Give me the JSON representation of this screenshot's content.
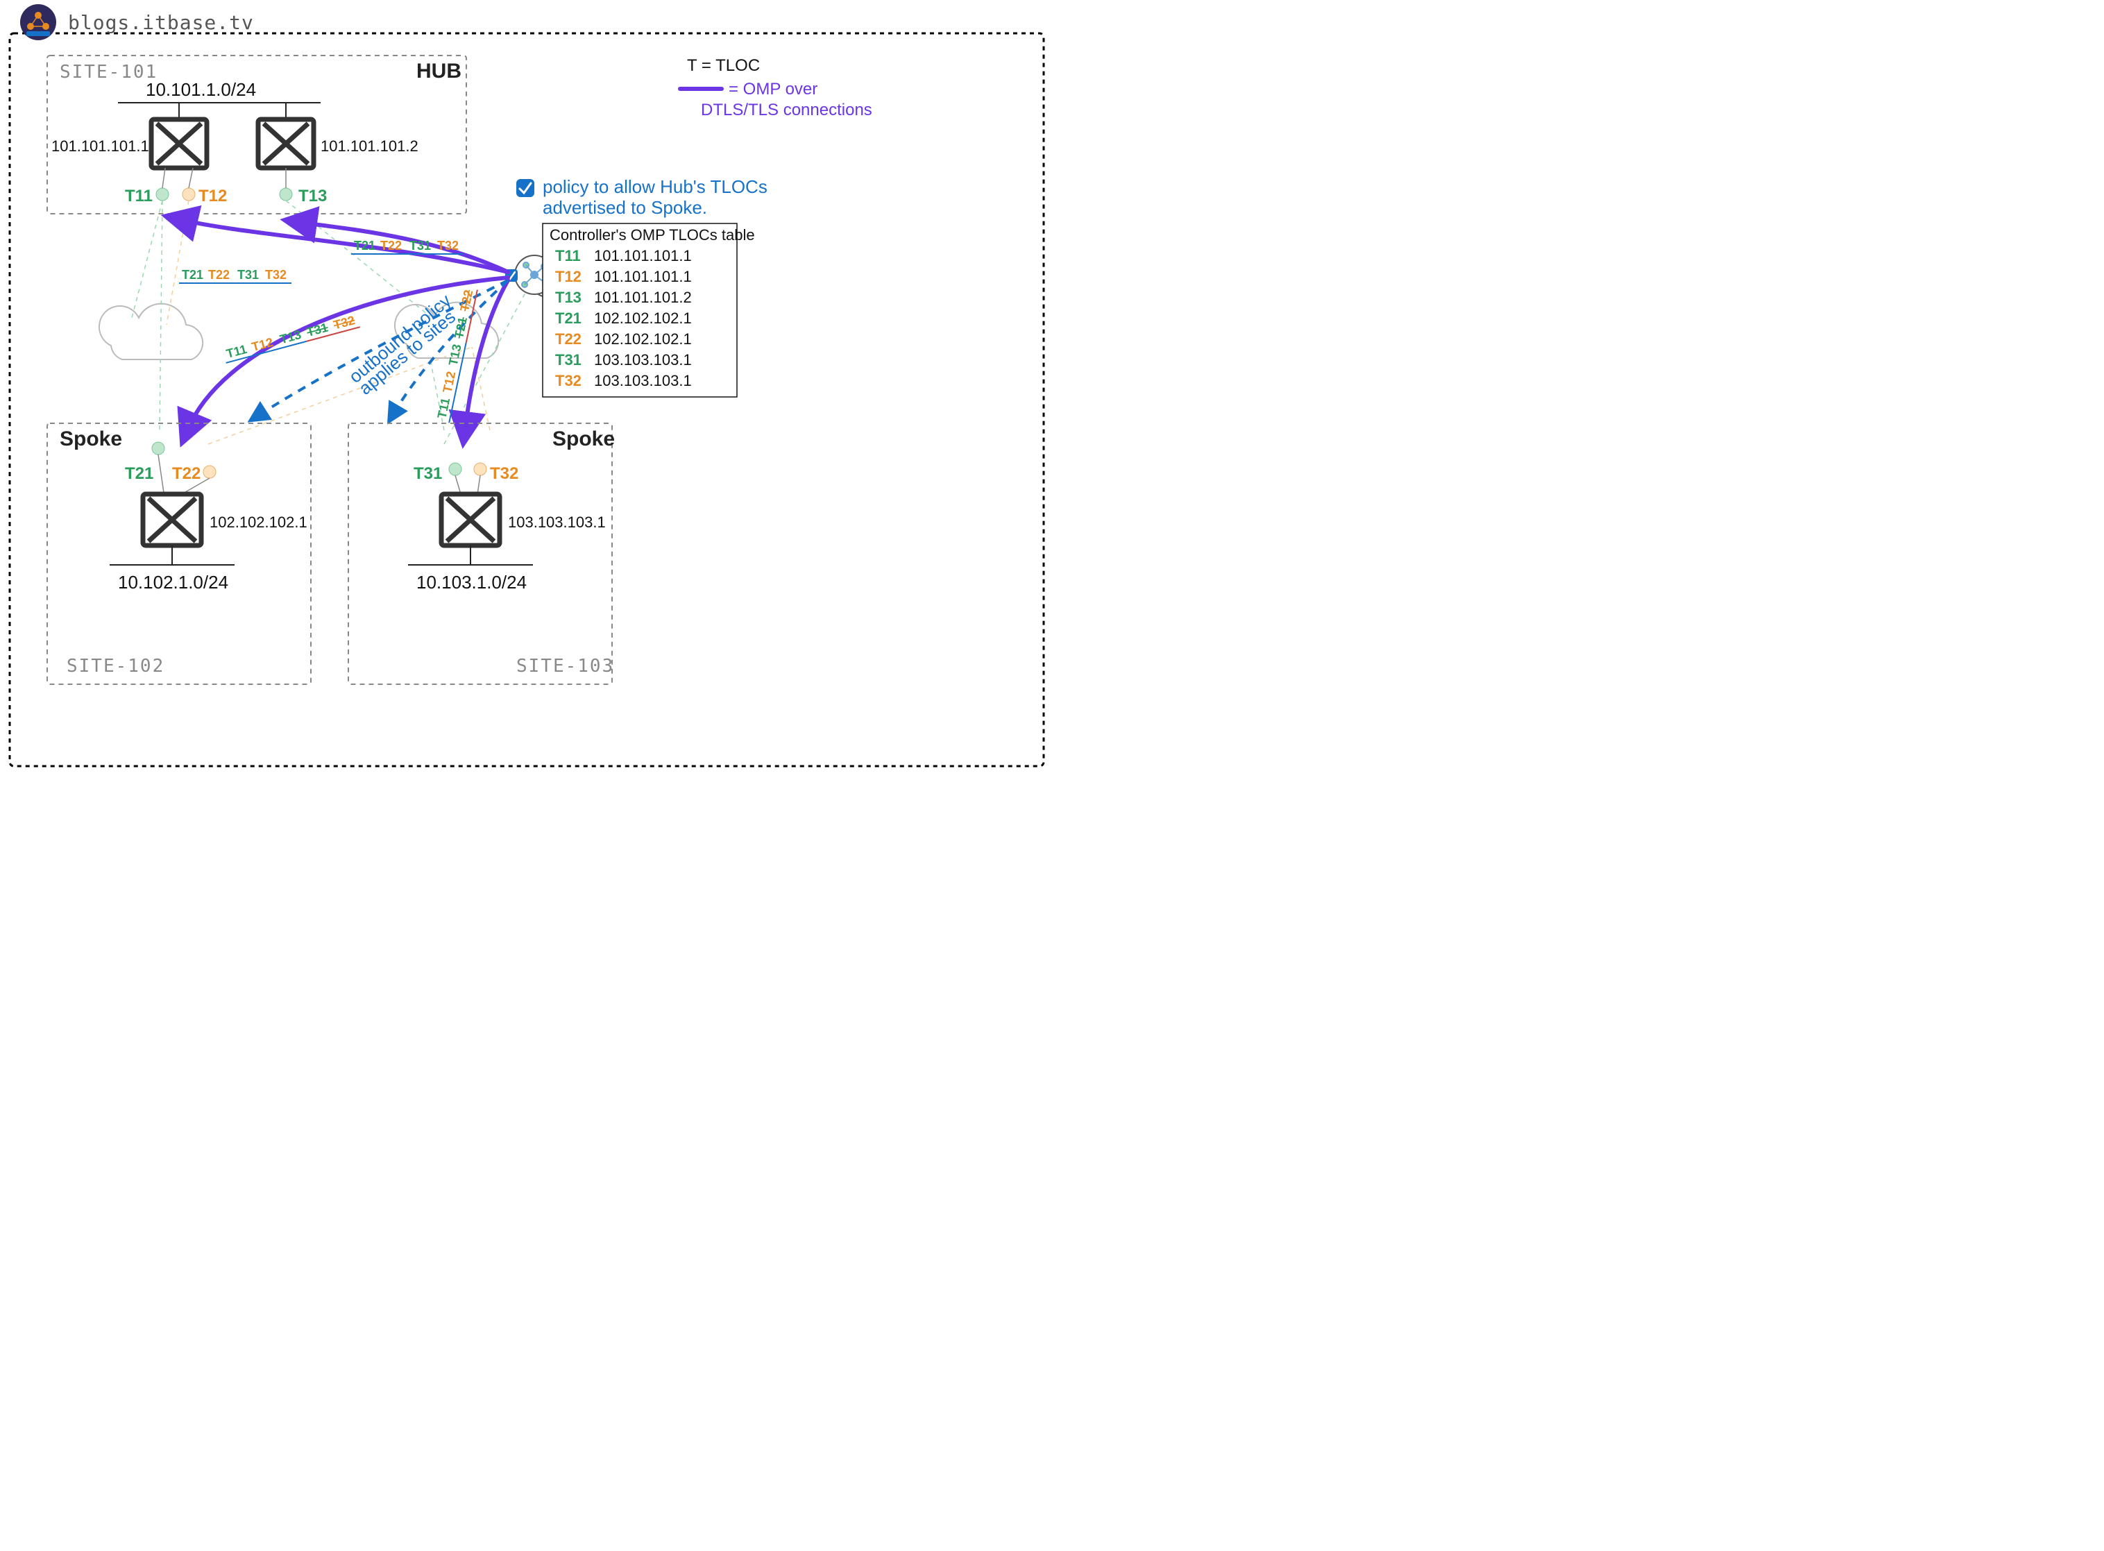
{
  "header": {
    "blog": "blogs.itbase.tv"
  },
  "legend": {
    "line1": "T = TLOC",
    "line2a": "= OMP over",
    "line2b": "DTLS/TLS connections"
  },
  "policy": {
    "line1": "policy to allow Hub's TLOCs",
    "line2": "advertised to Spoke.",
    "flowA": "outbound policy",
    "flowB": "applies to sites"
  },
  "controllerTable": {
    "title": "Controller's OMP TLOCs table",
    "rows": [
      {
        "t": "T11",
        "c": "g",
        "ip": "101.101.101.1"
      },
      {
        "t": "T12",
        "c": "o",
        "ip": "101.101.101.1"
      },
      {
        "t": "T13",
        "c": "g",
        "ip": "101.101.101.2"
      },
      {
        "t": "T21",
        "c": "g",
        "ip": "102.102.102.1"
      },
      {
        "t": "T22",
        "c": "o",
        "ip": "102.102.102.1"
      },
      {
        "t": "T31",
        "c": "g",
        "ip": "103.103.103.1"
      },
      {
        "t": "T32",
        "c": "o",
        "ip": "103.103.103.1"
      }
    ]
  },
  "site101": {
    "id": "SITE-101",
    "role": "HUB",
    "net": "10.101.1.0/24",
    "r1ip": "101.101.101.1",
    "r2ip": "101.101.101.2",
    "t11": "T11",
    "t12": "T12",
    "t13": "T13"
  },
  "site102": {
    "id": "SITE-102",
    "role": "Spoke",
    "net": "10.102.1.0/24",
    "ip": "102.102.102.1",
    "t21": "T21",
    "t22": "T22"
  },
  "site103": {
    "id": "SITE-103",
    "role": "Spoke",
    "net": "10.103.1.0/24",
    "ip": "103.103.103.1",
    "t31": "T31",
    "t32": "T32"
  },
  "edgeToHub1": {
    "a": "T21",
    "b": "T22",
    "c": "T31",
    "d": "T32"
  },
  "edgeToHub2": {
    "a": "T21",
    "b": "T22",
    "c": "T31",
    "d": "T32"
  },
  "edgeToSpoke102": {
    "a": "T11",
    "b": "T12",
    "c": "T13",
    "d": "T31",
    "e": "T32"
  },
  "edgeToSpoke103": {
    "a": "T11",
    "b": "T12",
    "c": "T13",
    "d": "T21",
    "e": "T22"
  }
}
